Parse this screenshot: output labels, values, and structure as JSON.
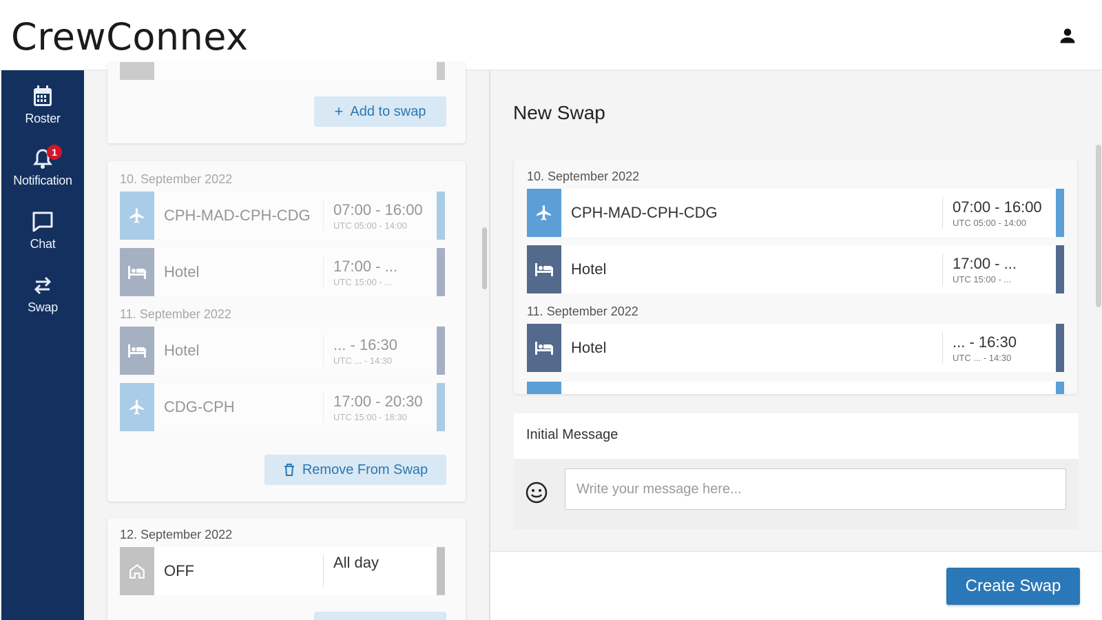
{
  "app": {
    "title": "CrewConnex"
  },
  "sidebar": {
    "items": [
      {
        "label": "Roster",
        "icon": "calendar-icon"
      },
      {
        "label": "Notification",
        "icon": "bell-icon",
        "badge": "1"
      },
      {
        "label": "Chat",
        "icon": "chat-icon"
      },
      {
        "label": "Swap",
        "icon": "swap-icon"
      }
    ]
  },
  "left": {
    "add_to_swap_label": "Add to swap",
    "remove_from_swap_label": "Remove From Swap",
    "group1": {
      "date1": "10. September 2022",
      "rows1": [
        {
          "title": "CPH-MAD-CPH-CDG",
          "time": "07:00 - 16:00",
          "utc": "UTC 05:00 - 14:00",
          "type": "flight"
        },
        {
          "title": "Hotel",
          "time": "17:00 - ...",
          "utc": "UTC 15:00 - ...",
          "type": "hotel"
        }
      ],
      "date2": "11. September 2022",
      "rows2": [
        {
          "title": "Hotel",
          "time": "... - 16:30",
          "utc": "UTC ... - 14:30",
          "type": "hotel"
        },
        {
          "title": "CDG-CPH",
          "time": "17:00 - 20:30",
          "utc": "UTC 15:00 - 18:30",
          "type": "flight"
        }
      ]
    },
    "group2": {
      "date": "12. September 2022",
      "row": {
        "title": "OFF",
        "time": "All day",
        "type": "off"
      }
    }
  },
  "right": {
    "title": "New Swap",
    "date1": "10. September 2022",
    "rows1": [
      {
        "title": "CPH-MAD-CPH-CDG",
        "time": "07:00 - 16:00",
        "utc": "UTC 05:00 - 14:00",
        "type": "flight"
      },
      {
        "title": "Hotel",
        "time": "17:00 - ...",
        "utc": "UTC 15:00 - ...",
        "type": "hotel"
      }
    ],
    "date2": "11. September 2022",
    "rows2": [
      {
        "title": "Hotel",
        "time": "... - 16:30",
        "utc": "UTC ... - 14:30",
        "type": "hotel"
      }
    ],
    "message": {
      "label": "Initial Message",
      "placeholder": "Write your message here...",
      "value": ""
    },
    "create_label": "Create Swap"
  },
  "colors": {
    "sidebar": "#13305f",
    "flight": "#5b9fd6",
    "hotel": "#536a8c",
    "off": "#9d9d9d",
    "primary": "#2a78b8"
  }
}
